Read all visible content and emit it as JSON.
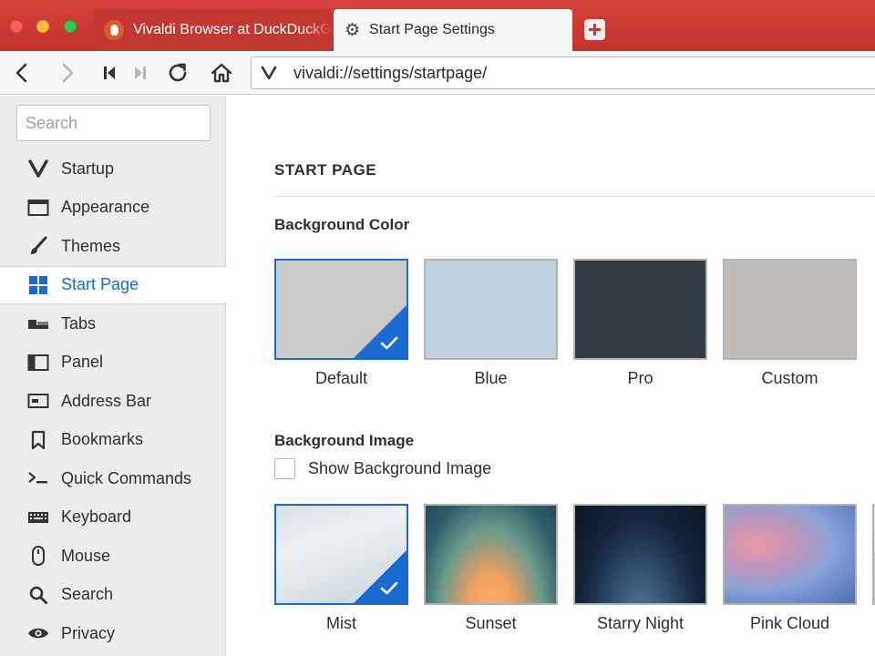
{
  "window": {
    "tabs": [
      {
        "label": "Vivaldi Browser at DuckDuckGo",
        "icon": "duckduckgo-icon",
        "active": false
      },
      {
        "label": "Start Page Settings",
        "icon": "gear-icon",
        "active": true
      }
    ]
  },
  "address": {
    "url": "vivaldi://settings/startpage/"
  },
  "sidebar": {
    "search_placeholder": "Search",
    "items": [
      {
        "label": "Startup",
        "icon": "vivaldi-logo-icon"
      },
      {
        "label": "Appearance",
        "icon": "window-icon"
      },
      {
        "label": "Themes",
        "icon": "brush-icon"
      },
      {
        "label": "Start Page",
        "icon": "grid-icon",
        "selected": true
      },
      {
        "label": "Tabs",
        "icon": "tabs-icon"
      },
      {
        "label": "Panel",
        "icon": "panel-icon"
      },
      {
        "label": "Address Bar",
        "icon": "address-bar-icon"
      },
      {
        "label": "Bookmarks",
        "icon": "bookmark-icon"
      },
      {
        "label": "Quick Commands",
        "icon": "quick-commands-icon"
      },
      {
        "label": "Keyboard",
        "icon": "keyboard-icon"
      },
      {
        "label": "Mouse",
        "icon": "mouse-icon"
      },
      {
        "label": "Search",
        "icon": "search-icon"
      },
      {
        "label": "Privacy",
        "icon": "eye-icon"
      }
    ]
  },
  "main": {
    "section_title": "START PAGE",
    "background_color": {
      "title": "Background Color",
      "options": [
        {
          "label": "Default",
          "color": "#cbcbcb",
          "selected": true
        },
        {
          "label": "Blue",
          "color": "#bfd1de",
          "selected": false
        },
        {
          "label": "Pro",
          "color": "#323a44",
          "selected": false
        },
        {
          "label": "Custom",
          "color": "#c2bcb8",
          "selected": false
        }
      ]
    },
    "background_image": {
      "title": "Background Image",
      "checkbox_label": "Show Background Image",
      "checked": false,
      "options": [
        {
          "label": "Mist",
          "selected": true
        },
        {
          "label": "Sunset",
          "selected": false
        },
        {
          "label": "Starry Night",
          "selected": false
        },
        {
          "label": "Pink Cloud",
          "selected": false
        }
      ]
    }
  },
  "colors": {
    "accent": "#1a6bd1",
    "titlebar": "#cb3a34"
  }
}
